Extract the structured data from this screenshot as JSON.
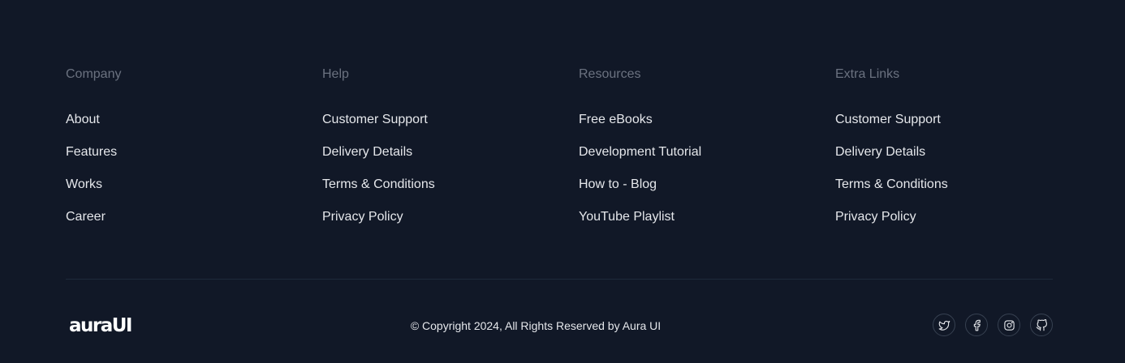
{
  "columns": [
    {
      "heading": "Company",
      "links": [
        "About",
        "Features",
        "Works",
        "Career"
      ]
    },
    {
      "heading": "Help",
      "links": [
        "Customer Support",
        "Delivery Details",
        "Terms & Conditions",
        "Privacy Policy"
      ]
    },
    {
      "heading": "Resources",
      "links": [
        "Free eBooks",
        "Development Tutorial",
        "How to - Blog",
        "YouTube Playlist"
      ]
    },
    {
      "heading": "Extra Links",
      "links": [
        "Customer Support",
        "Delivery Details",
        "Terms & Conditions",
        "Privacy Policy"
      ]
    }
  ],
  "bottom": {
    "logo": "auraUI",
    "copyright": "© Copyright 2024, All Rights Reserved by Aura UI",
    "socials": [
      "twitter-icon",
      "facebook-icon",
      "instagram-icon",
      "github-icon"
    ]
  },
  "colors": {
    "background": "#111827",
    "heading": "#6b7280",
    "link": "#e5e7eb",
    "divider": "#1f2a3b",
    "icon_border": "#374151"
  }
}
